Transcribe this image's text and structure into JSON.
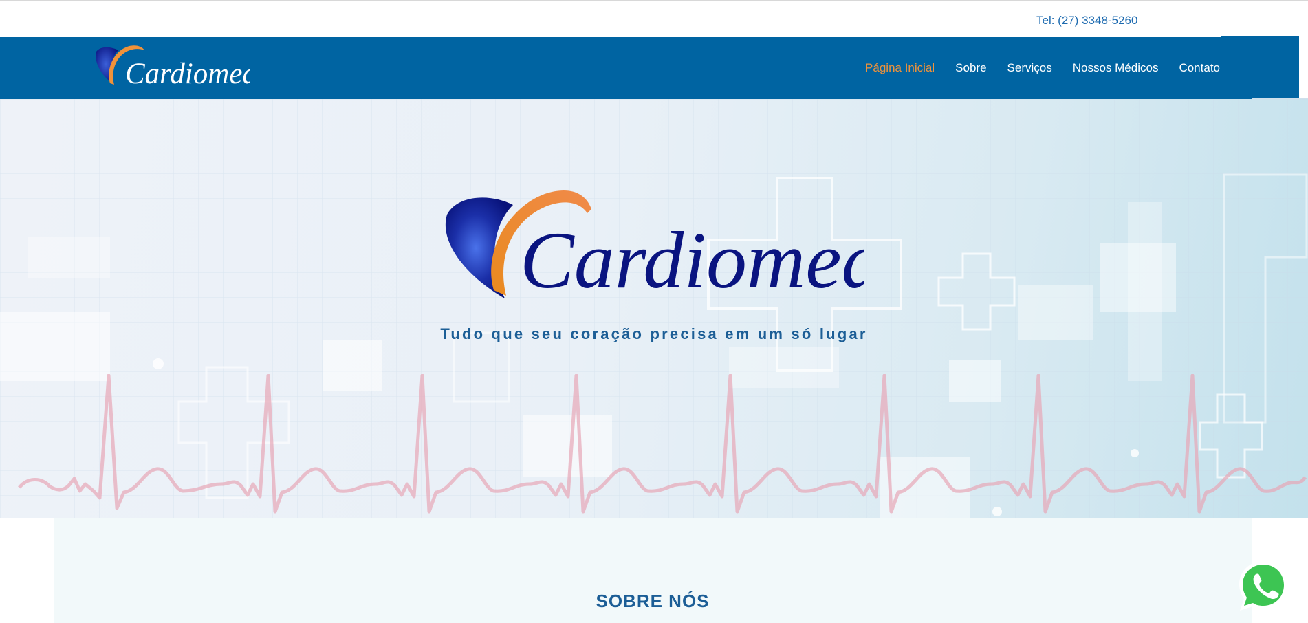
{
  "topbar": {
    "phone_label": "Tel: (27) 3348-5260"
  },
  "brand": {
    "name": "Cardiomed",
    "colors": {
      "nav_blue": "#0064a2",
      "logo_navy": "#0a1480",
      "logo_orange": "#f0923a",
      "heading_blue": "#1c5e96"
    }
  },
  "nav": {
    "items": [
      {
        "label": "Página Inicial",
        "active": true
      },
      {
        "label": "Sobre"
      },
      {
        "label": "Serviços"
      },
      {
        "label": "Nossos Médicos"
      },
      {
        "label": "Contato"
      }
    ]
  },
  "hero": {
    "logo_text": "Cardiomed",
    "tagline": "Tudo que seu coração precisa em um só lugar"
  },
  "about": {
    "title": "SOBRE NÓS"
  },
  "icons": {
    "whatsapp": "whatsapp-icon",
    "nav_logo": "cardiomed-logo-icon",
    "hero_logo": "cardiomed-heart-icon"
  }
}
